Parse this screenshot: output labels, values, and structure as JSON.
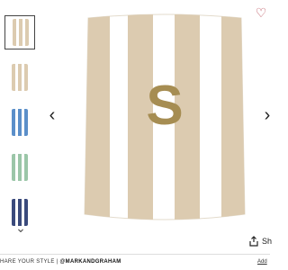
{
  "product": {
    "monogram_letter": "S",
    "stripe_color": "#dccbb0",
    "monogram_color": "#a68d52"
  },
  "gallery": {
    "thumbnails": [
      {
        "name": "beige-stripe-towel-monogram",
        "color": "#dccbb0",
        "active": true
      },
      {
        "name": "beige-stripe-towel-folded",
        "color": "#dccbb0",
        "active": false
      },
      {
        "name": "blue-stripe-towel",
        "color": "#5b8fc9",
        "active": false
      },
      {
        "name": "multicolor-towel-stack",
        "color": "#9bc6a8",
        "active": false
      },
      {
        "name": "navy-stripe-towel",
        "color": "#3a4a7c",
        "active": false
      }
    ]
  },
  "actions": {
    "share_label": "Sh"
  },
  "footer": {
    "share_text": "HARE YOUR STYLE | ",
    "handle": "@MARKANDGRAHAM",
    "add_label": "Add"
  },
  "icons": {
    "wishlist": "heart-icon",
    "prev": "chevron-left-icon",
    "next": "chevron-right-icon",
    "more": "chevron-down-icon",
    "share": "share-icon"
  }
}
